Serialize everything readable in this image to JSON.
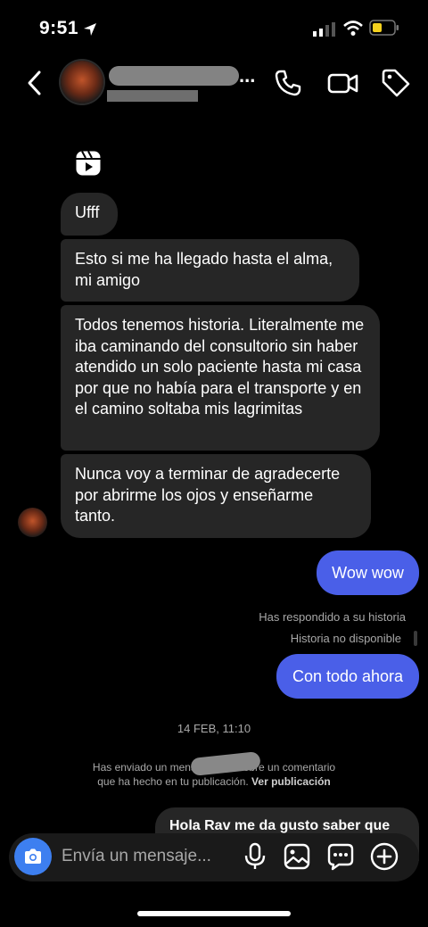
{
  "status_bar": {
    "time": "9:51"
  },
  "header": {
    "name_suffix": "..."
  },
  "messages": {
    "incoming": [
      "Ufff",
      "Esto si me ha llegado hasta el alma, mi amigo",
      "Todos tenemos historia. Literalmente me iba caminando del consultorio sin haber atendido un solo paciente hasta mi casa por que no había para el transporte y en el camino soltaba mis lagrimitas",
      "Nunca voy a terminar de agradecerte por abrirme los ojos y enseñarme tanto."
    ],
    "outgoing_1": "Wow wow",
    "story_reply_note": "Has respondido a su historia",
    "story_unavailable": "Historia no disponible",
    "outgoing_2": "Con todo ahora",
    "date_separator": "14 FEB, 11:10",
    "notice_part1": "Has enviado un mensaje a",
    "notice_part2": "sobre un comentario",
    "notice_part3": "que ha hecho en tu publicación.",
    "notice_link": "Ver publicación",
    "outgoing_3_partial": "Hola Rav me da gusto saber que"
  },
  "composer": {
    "placeholder": "Envía un mensaje..."
  },
  "colors": {
    "accent": "#4a5fe8",
    "camera": "#3d7ff0",
    "bubble_in": "#262626"
  }
}
